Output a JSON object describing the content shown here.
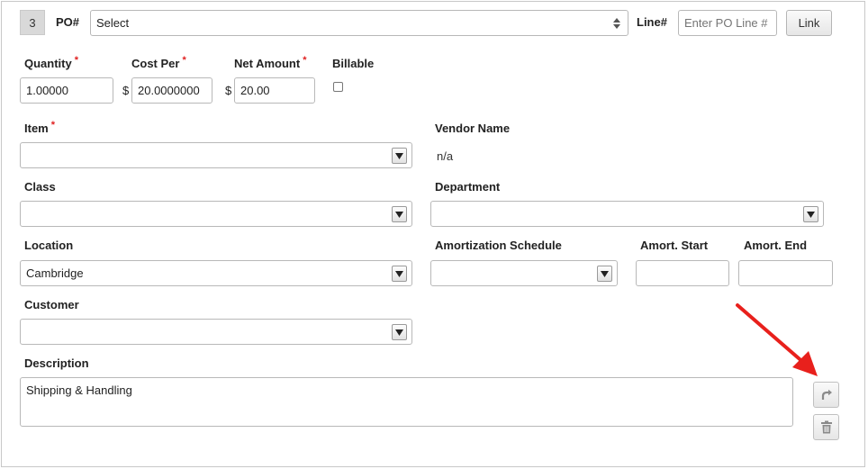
{
  "line": {
    "number": "3"
  },
  "po": {
    "label": "PO#",
    "select_value": "Select",
    "line_label": "Line#",
    "line_placeholder": "Enter PO Line #",
    "link_button": "Link"
  },
  "quantity": {
    "label": "Quantity",
    "required": "*",
    "value": "1.00000"
  },
  "cost_per": {
    "label": "Cost Per",
    "required": "*",
    "currency": "$",
    "value": "20.0000000"
  },
  "net_amount": {
    "label": "Net Amount",
    "required": "*",
    "currency": "$",
    "value": "20.00"
  },
  "billable": {
    "label": "Billable",
    "checked": false
  },
  "item": {
    "label": "Item",
    "required": "*",
    "value": ""
  },
  "vendor_name": {
    "label": "Vendor Name",
    "value": "n/a"
  },
  "class": {
    "label": "Class",
    "value": ""
  },
  "department": {
    "label": "Department",
    "value": ""
  },
  "location": {
    "label": "Location",
    "value": "Cambridge"
  },
  "amortization_schedule": {
    "label": "Amortization Schedule",
    "value": ""
  },
  "amort_start": {
    "label": "Amort. Start",
    "value": ""
  },
  "amort_end": {
    "label": "Amort. End",
    "value": ""
  },
  "customer": {
    "label": "Customer",
    "value": ""
  },
  "description": {
    "label": "Description",
    "value": "Shipping & Handling"
  },
  "actions": {
    "copy_icon": "redo-icon",
    "delete_icon": "trash-icon"
  },
  "colors": {
    "required": "#e02020",
    "annotation_arrow": "#e8201c",
    "badge_bg": "#d9d9d9"
  }
}
